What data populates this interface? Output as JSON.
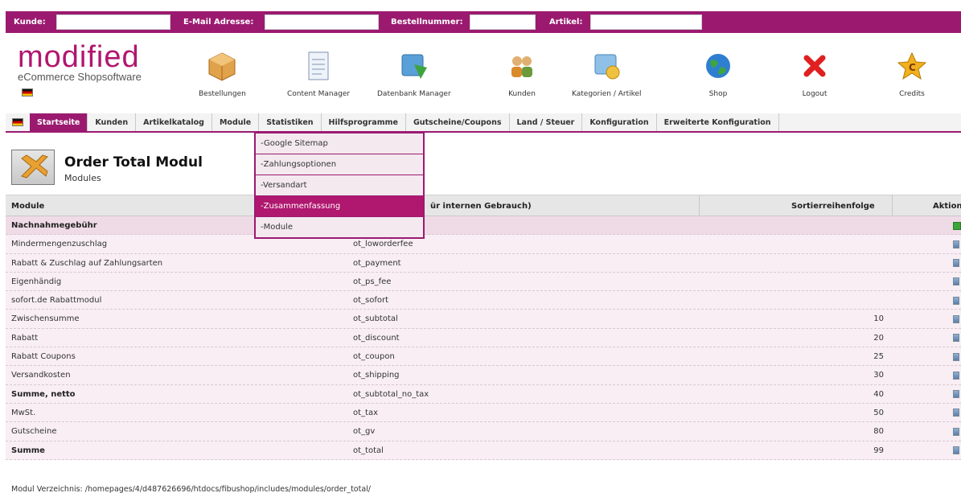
{
  "search_bar": {
    "customer_label": "Kunde:",
    "email_label": "E-Mail Adresse:",
    "order_label": "Bestellnummer:",
    "article_label": "Artikel:"
  },
  "logo": {
    "wordmark": "modified",
    "tagline": "eCommerce Shopsoftware"
  },
  "header_items": [
    {
      "label": "Bestellungen",
      "icon": "box-icon"
    },
    {
      "label": "Content Manager",
      "icon": "document-icon"
    },
    {
      "label": "Datenbank Manager",
      "icon": "database-icon"
    },
    {
      "label": "Kunden",
      "icon": "users-icon"
    },
    {
      "label": "Kategorien / Artikel",
      "icon": "categories-icon"
    },
    {
      "label": "Shop",
      "icon": "globe-icon"
    },
    {
      "label": "Logout",
      "icon": "close-icon"
    },
    {
      "label": "Credits",
      "icon": "star-icon"
    }
  ],
  "nav": [
    {
      "label": "Startseite",
      "active": true
    },
    {
      "label": "Kunden"
    },
    {
      "label": "Artikelkatalog"
    },
    {
      "label": "Module"
    },
    {
      "label": "Statistiken"
    },
    {
      "label": "Hilfsprogramme"
    },
    {
      "label": "Gutscheine/Coupons"
    },
    {
      "label": "Land / Steuer"
    },
    {
      "label": "Konfiguration"
    },
    {
      "label": "Erweiterte Konfiguration"
    }
  ],
  "dropdown": [
    {
      "label": "-Google Sitemap"
    },
    {
      "label": "-Zahlungsoptionen"
    },
    {
      "label": "-Versandart"
    },
    {
      "label": "-Zusammenfassung",
      "hover": true
    },
    {
      "label": "-Module"
    }
  ],
  "page": {
    "title": "Order Total Modul",
    "subtitle": "Modules"
  },
  "table": {
    "headers": {
      "module": "Module",
      "code": "ür internen Gebrauch)",
      "sort": "Sortierreihenfolge",
      "action": "Aktion"
    },
    "rows": [
      {
        "title": "Nachnahmegebühr",
        "code": "",
        "sort": "",
        "bold": true
      },
      {
        "title": "Mindermengenzuschlag",
        "code": "ot_loworderfee",
        "sort": ""
      },
      {
        "title": "Rabatt & Zuschlag auf Zahlungsarten",
        "code": "ot_payment",
        "sort": ""
      },
      {
        "title": "Eigenhändig",
        "code": "ot_ps_fee",
        "sort": ""
      },
      {
        "title": "sofort.de Rabattmodul",
        "code": "ot_sofort",
        "sort": ""
      },
      {
        "title": "Zwischensumme",
        "code": "ot_subtotal",
        "sort": "10"
      },
      {
        "title": "Rabatt",
        "code": "ot_discount",
        "sort": "20"
      },
      {
        "title": "Rabatt Coupons",
        "code": "ot_coupon",
        "sort": "25"
      },
      {
        "title": "Versandkosten",
        "code": "ot_shipping",
        "sort": "30"
      },
      {
        "title": "Summe, netto",
        "code": "ot_subtotal_no_tax",
        "sort": "40",
        "bold": true
      },
      {
        "title": "MwSt.",
        "code": "ot_tax",
        "sort": "50"
      },
      {
        "title": "Gutscheine",
        "code": "ot_gv",
        "sort": "80"
      },
      {
        "title": "Summe",
        "code": "ot_total",
        "sort": "99",
        "bold": true
      }
    ]
  },
  "footer": {
    "text": "Modul Verzeichnis: /homepages/4/d487626696/htdocs/fibushop/includes/modules/order_total/"
  },
  "colors": {
    "brand": "#9b1a70",
    "hover": "#b0176f"
  }
}
